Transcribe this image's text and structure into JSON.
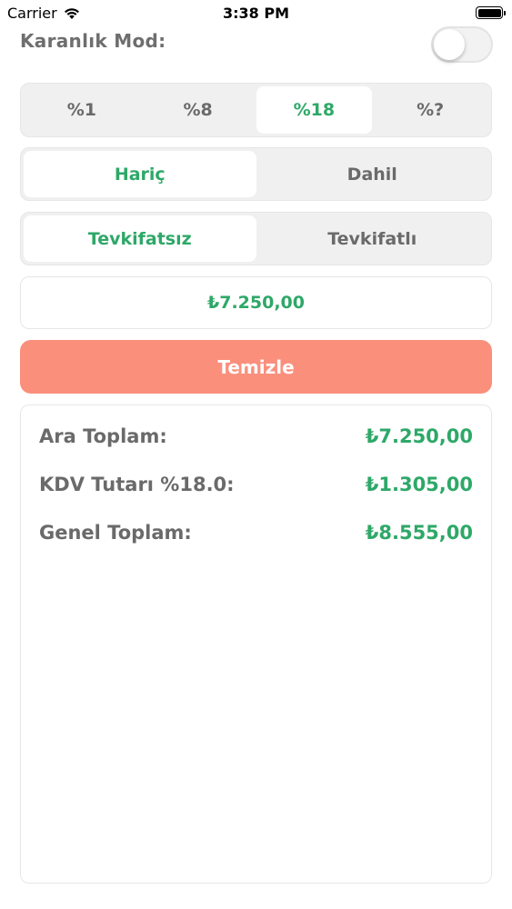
{
  "status": {
    "carrier": "Carrier",
    "time": "3:38 PM"
  },
  "dark_mode": {
    "label": "Karanlık Mod:",
    "enabled": false
  },
  "rates": {
    "options": [
      "%1",
      "%8",
      "%18",
      "%?"
    ],
    "selected": "%18"
  },
  "mode": {
    "options": [
      "Hariç",
      "Dahil"
    ],
    "selected": "Hariç"
  },
  "withholding": {
    "options": [
      "Tevkifatsız",
      "Tevkifatlı"
    ],
    "selected": "Tevkifatsız"
  },
  "amount": {
    "value": "₺7.250,00"
  },
  "clear_button": {
    "label": "Temizle"
  },
  "results": [
    {
      "label": "Ara Toplam:",
      "value": "₺7.250,00"
    },
    {
      "label": "KDV Tutarı %18.0:",
      "value": "₺1.305,00"
    },
    {
      "label": "Genel Toplam:",
      "value": "₺8.555,00"
    }
  ],
  "colors": {
    "accent": "#2ea868",
    "clear": "#fa8f7c"
  }
}
